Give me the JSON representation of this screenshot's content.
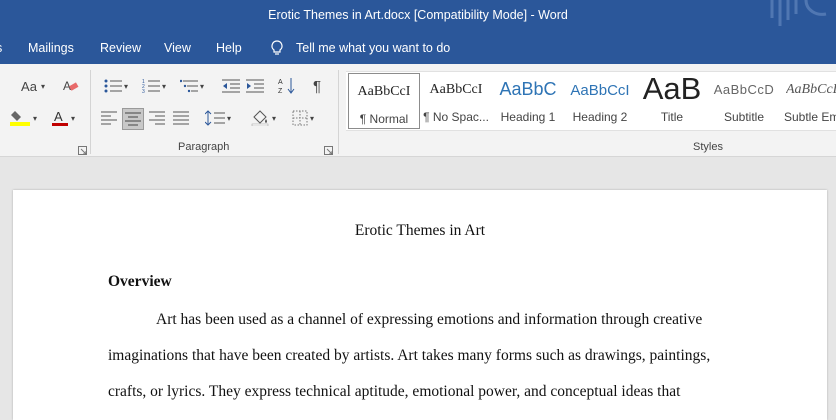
{
  "window": {
    "title": "Erotic Themes in Art.docx [Compatibility Mode]  -  Word"
  },
  "menu": {
    "tabs": [
      "Mailings",
      "Review",
      "View",
      "Help"
    ],
    "tell_me": "Tell me what you want to do"
  },
  "ribbon": {
    "font": {
      "change_case": "Aa"
    },
    "paragraph": {
      "label": "Paragraph"
    },
    "styles": {
      "label": "Styles",
      "items": [
        {
          "sample": "AaBbCcI",
          "name": "¶ Normal"
        },
        {
          "sample": "AaBbCcI",
          "name": "¶ No Spac..."
        },
        {
          "sample": "AaBbC",
          "name": "Heading 1"
        },
        {
          "sample": "AaBbCcI",
          "name": "Heading 2"
        },
        {
          "sample": "AaB",
          "name": "Title"
        },
        {
          "sample": "AaBbCcD",
          "name": "Subtitle"
        },
        {
          "sample": "AaBbCcD",
          "name": "Subtle Em"
        }
      ]
    }
  },
  "document": {
    "title": "Erotic Themes in Art",
    "heading": "Overview",
    "lines": [
      "Art has been used as a channel of expressing emotions and information through creative",
      "imaginations that have been created by artists. Art takes many forms such as drawings, paintings,",
      "crafts, or lyrics. They express technical aptitude, emotional power, and conceptual ideas that"
    ]
  },
  "colors": {
    "accent": "#2b579a",
    "ribbon_bg": "#f3f3f3",
    "page_bg": "#e6e6e6",
    "highlight": "#ffff00",
    "font_color": "#c00000"
  }
}
